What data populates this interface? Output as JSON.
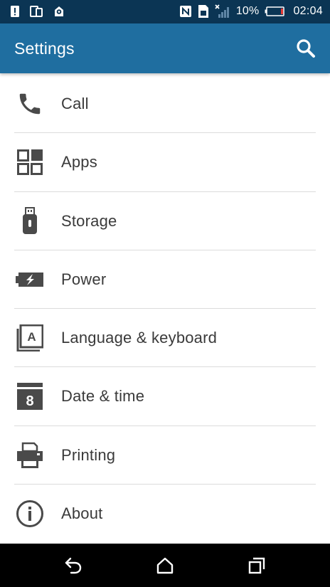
{
  "status_bar": {
    "battery_percent": "10%",
    "time": "02:04",
    "icons": [
      "alert-icon",
      "dual-screen-icon",
      "location-icon",
      "nfc-icon",
      "sim-icon",
      "signal-no-service-icon",
      "battery-low-icon"
    ]
  },
  "header": {
    "title": "Settings",
    "search_icon": "search-icon"
  },
  "settings": {
    "items": [
      {
        "label": "Call",
        "icon": "phone-icon"
      },
      {
        "label": "Apps",
        "icon": "apps-grid-icon"
      },
      {
        "label": "Storage",
        "icon": "usb-storage-icon"
      },
      {
        "label": "Power",
        "icon": "battery-charging-icon"
      },
      {
        "label": "Language & keyboard",
        "icon": "keyboard-language-icon"
      },
      {
        "label": "Date & time",
        "icon": "calendar-icon"
      },
      {
        "label": "Printing",
        "icon": "printer-icon"
      },
      {
        "label": "About",
        "icon": "info-icon"
      }
    ]
  },
  "nav": {
    "buttons": [
      "back-icon",
      "home-icon",
      "recents-icon"
    ]
  },
  "colors": {
    "status_bar": "#0b3554",
    "action_bar": "#1f6ea0",
    "icon_gray": "#4a4a4a",
    "text": "#3a3a3a",
    "divider": "#dcdcdc",
    "battery_low": "#e53935"
  }
}
